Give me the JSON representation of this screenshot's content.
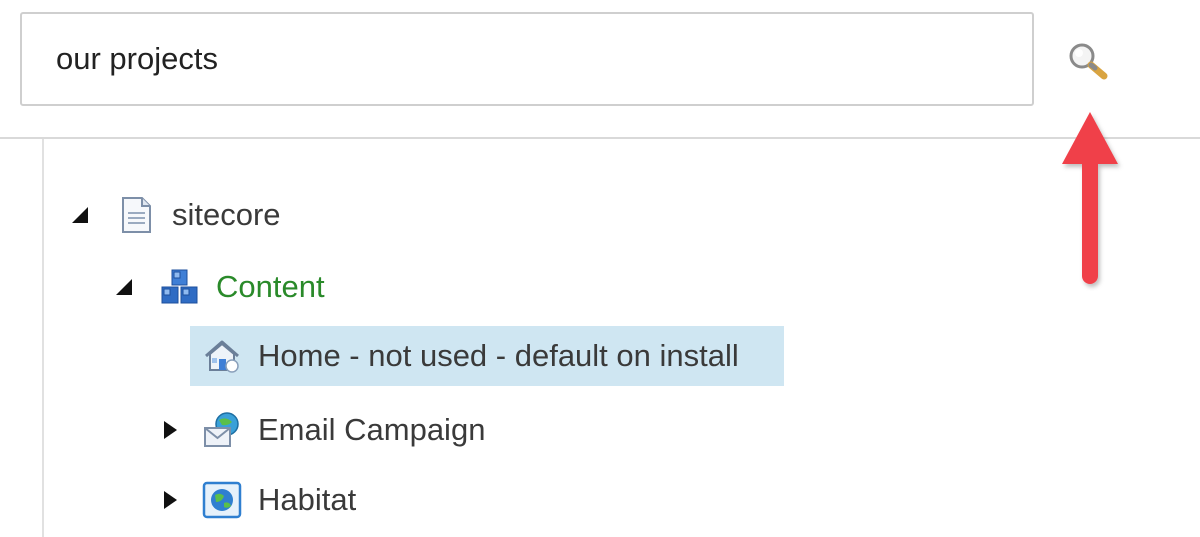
{
  "search": {
    "value": "our projects",
    "icon": "magnifier-icon"
  },
  "annotation": {
    "icon": "arrow-up-icon",
    "color": "#f0404a"
  },
  "tree": {
    "root": {
      "label": "sitecore",
      "expanded": true,
      "icon": "document-icon"
    },
    "content": {
      "label": "Content",
      "expanded": true,
      "icon": "cubes-icon",
      "color": "#2a8a2a"
    },
    "items": [
      {
        "label": "Home - not used - default on install",
        "icon": "home-icon",
        "selected": true,
        "has_children": false
      },
      {
        "label": "Email Campaign",
        "icon": "email-campaign-icon",
        "selected": false,
        "has_children": true,
        "expanded": false
      },
      {
        "label": "Habitat",
        "icon": "globe-icon",
        "selected": false,
        "has_children": true,
        "expanded": false
      }
    ]
  },
  "colors": {
    "selection": "#cfe6f2",
    "border": "#cfcfcf"
  }
}
